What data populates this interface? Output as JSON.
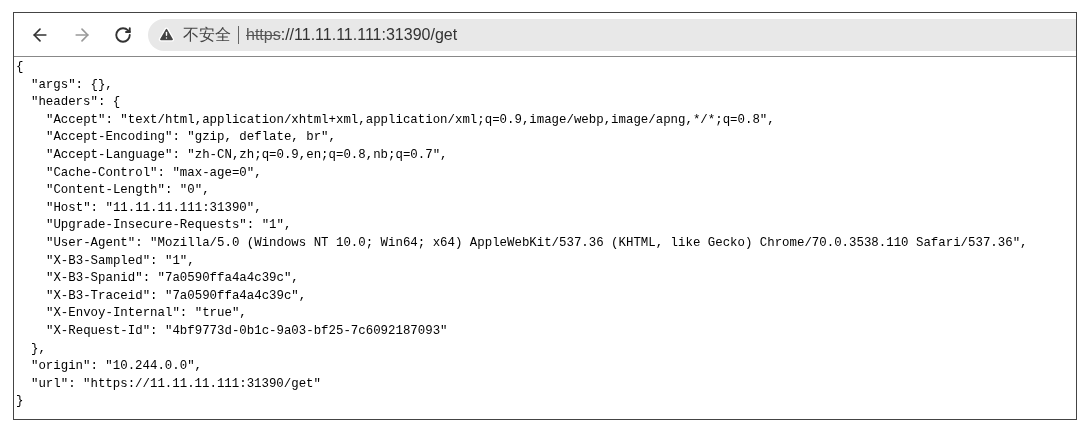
{
  "toolbar": {
    "security_label": "不安全",
    "url": {
      "scheme": "https",
      "rest": "://11.11.11.111:31390/get"
    }
  },
  "body": [
    {
      "text": "{",
      "children": [
        {
          "text": "\"args\": {},"
        },
        {
          "text": "\"headers\": {",
          "children": [
            {
              "text": "\"Accept\": \"text/html,application/xhtml+xml,application/xml;q=0.9,image/webp,image/apng,*/*;q=0.8\","
            },
            {
              "text": "\"Accept-Encoding\": \"gzip, deflate, br\","
            },
            {
              "text": "\"Accept-Language\": \"zh-CN,zh;q=0.9,en;q=0.8,nb;q=0.7\","
            },
            {
              "text": "\"Cache-Control\": \"max-age=0\","
            },
            {
              "text": "\"Content-Length\": \"0\","
            },
            {
              "text": "\"Host\": \"11.11.11.111:31390\","
            },
            {
              "text": "\"Upgrade-Insecure-Requests\": \"1\","
            },
            {
              "text": "\"User-Agent\": \"Mozilla/5.0 (Windows NT 10.0; Win64; x64) AppleWebKit/537.36 (KHTML, like Gecko) Chrome/70.0.3538.110 Safari/537.36\","
            },
            {
              "text": "\"X-B3-Sampled\": \"1\","
            },
            {
              "text": "\"X-B3-Spanid\": \"7a0590ffa4a4c39c\","
            },
            {
              "text": "\"X-B3-Traceid\": \"7a0590ffa4a4c39c\","
            },
            {
              "text": "\"X-Envoy-Internal\": \"true\","
            },
            {
              "text": "\"X-Request-Id\": \"4bf9773d-0b1c-9a03-bf25-7c6092187093\""
            }
          ]
        },
        {
          "text": "},"
        },
        {
          "text": "\"origin\": \"10.244.0.0\","
        },
        {
          "text": "\"url\": \"https://11.11.11.111:31390/get\""
        }
      ]
    },
    {
      "text": "}"
    }
  ]
}
